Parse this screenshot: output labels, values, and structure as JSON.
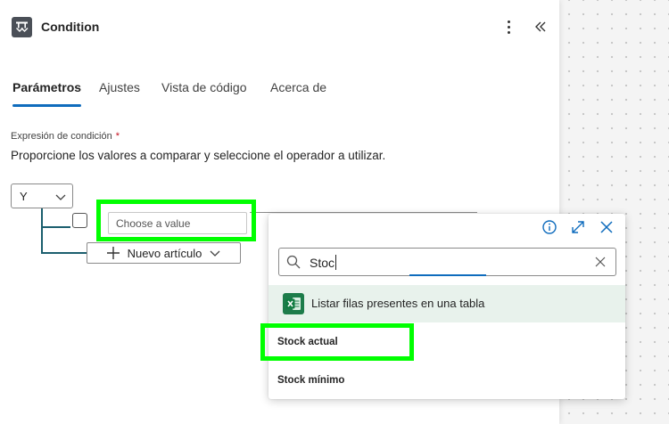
{
  "header": {
    "title": "Condition"
  },
  "tabs": [
    {
      "label": "Parámetros",
      "active": true
    },
    {
      "label": "Ajustes",
      "active": false
    },
    {
      "label": "Vista de código",
      "active": false
    },
    {
      "label": "Acerca de",
      "active": false
    }
  ],
  "condition": {
    "label": "Expresión de condición",
    "required_mark": "*",
    "help_text": "Proporcione los valores a comparar y seleccione el operador a utilizar.",
    "group_operator": "Y",
    "value_placeholder": "Choose a value",
    "new_item_label": "Nuevo artículo"
  },
  "picker": {
    "search_value": "Stoc",
    "action_label": "Listar filas presentes en una tabla",
    "results": [
      "Stock actual",
      "Stock mínimo"
    ]
  },
  "colors": {
    "accent": "#0f6cbd",
    "highlight": "#00ff00",
    "tree_line": "#1b5e6e",
    "excel": "#1d7c4a"
  }
}
